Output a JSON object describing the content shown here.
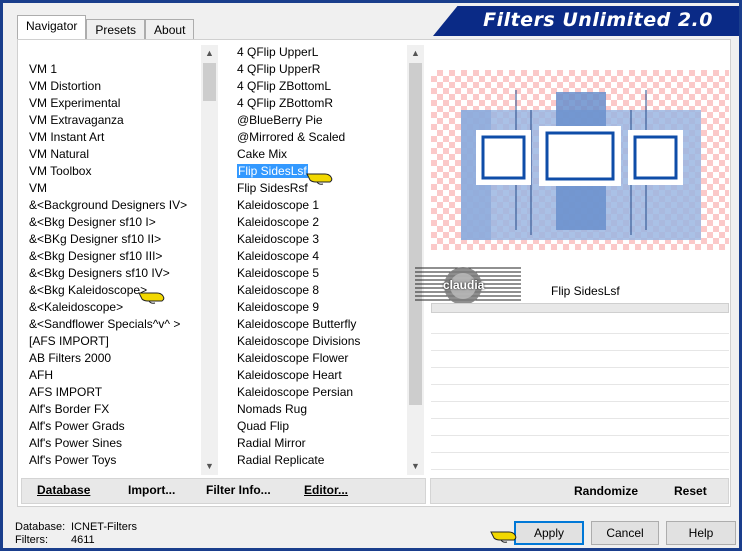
{
  "title": "Filters Unlimited 2.0",
  "tabs": [
    "Navigator",
    "Presets",
    "About"
  ],
  "categories": [
    "VM 1",
    "VM Distortion",
    "VM Experimental",
    "VM Extravaganza",
    "VM Instant Art",
    "VM Natural",
    "VM Toolbox",
    "VM",
    "&<Background Designers IV>",
    "&<Bkg Designer sf10 I>",
    "&<BKg Designer sf10 II>",
    "&<Bkg Designer sf10 III>",
    "&<Bkg Designers sf10 IV>",
    "&<Bkg Kaleidoscope>",
    "&<Kaleidoscope>",
    "&<Sandflower Specials^v^ >",
    "[AFS IMPORT]",
    "AB Filters 2000",
    "AFH",
    "AFS IMPORT",
    "Alf's Border FX",
    "Alf's Power Grads",
    "Alf's Power Sines",
    "Alf's Power Toys"
  ],
  "filters": [
    "4 QFlip UpperL",
    "4 QFlip UpperR",
    "4 QFlip ZBottomL",
    "4 QFlip ZBottomR",
    "@BlueBerry Pie",
    "@Mirrored & Scaled",
    "Cake Mix",
    "Flip SidesLsf",
    "Flip SidesRsf",
    "Kaleidoscope 1",
    "Kaleidoscope 2",
    "Kaleidoscope 3",
    "Kaleidoscope 4",
    "Kaleidoscope 5",
    "Kaleidoscope 8",
    "Kaleidoscope 9",
    "Kaleidoscope Butterfly",
    "Kaleidoscope Divisions",
    "Kaleidoscope Flower",
    "Kaleidoscope Heart",
    "Kaleidoscope Persian",
    "Nomads Rug",
    "Quad Flip",
    "Radial Mirror",
    "Radial Replicate"
  ],
  "selected_filter_name": "Flip SidesLsf",
  "watermark_text": "claudia",
  "buttons": {
    "database": "Database",
    "import": "Import...",
    "filter_info": "Filter Info...",
    "editor": "Editor...",
    "randomize": "Randomize",
    "reset": "Reset",
    "apply": "Apply",
    "cancel": "Cancel",
    "help": "Help"
  },
  "footer": {
    "database_label": "Database:",
    "database_value": "ICNET-Filters",
    "filters_label": "Filters:",
    "filters_value": "4611"
  },
  "colors": {
    "title_bg": "#0a2a86",
    "selection": "#3399ff",
    "pointer_hand": "#f2d800"
  },
  "icons": [
    "pointing-hand-icon",
    "scroll-up-icon",
    "scroll-down-icon"
  ]
}
